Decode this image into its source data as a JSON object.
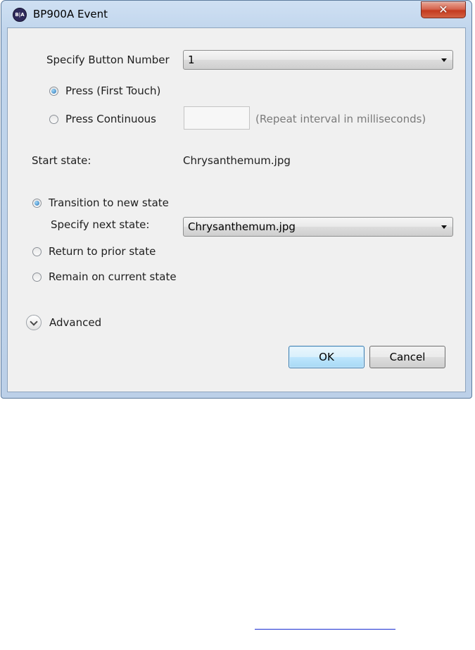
{
  "window": {
    "title": "BP900A Event",
    "icon_text": "B|A",
    "close_glyph": "✕"
  },
  "button_number": {
    "label": "Specify Button Number",
    "value": "1"
  },
  "press_mode": {
    "first_touch_label": "Press (First Touch)",
    "continuous_label": "Press Continuous",
    "interval_value": "",
    "interval_hint": "(Repeat interval in milliseconds)",
    "selected": "first_touch"
  },
  "start_state": {
    "label": "Start state:",
    "value": "Chrysanthemum.jpg"
  },
  "transition": {
    "new_state_label": "Transition to new state",
    "next_state_label": "Specify next state:",
    "next_state_value": "Chrysanthemum.jpg",
    "prior_label": "Return to prior state",
    "remain_label": "Remain on current state",
    "selected": "new_state"
  },
  "advanced": {
    "label": "Advanced"
  },
  "buttons": {
    "ok": "OK",
    "cancel": "Cancel"
  },
  "colors": {
    "accent": "#3c7fb1",
    "close": "#c43b1f",
    "panel": "#f0f0f0",
    "link_underline": "#1b2fd1"
  },
  "icons": {
    "app": "app-logo-icon",
    "close": "close-icon",
    "dropdown": "chevron-down-icon",
    "expander": "chevron-down-circle-icon"
  }
}
